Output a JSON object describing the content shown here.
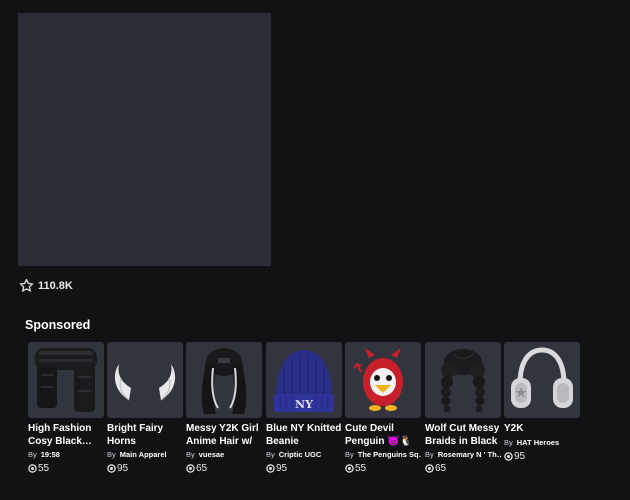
{
  "favorites": {
    "count": "110.8K"
  },
  "sponsored": {
    "title": "Sponsored",
    "by_label": "By",
    "items": [
      {
        "name": "High Fashion Cosy Black…",
        "creator": "19:58",
        "price": "55",
        "icon": "black-scarf-icon"
      },
      {
        "name": "Bright Fairy Horns",
        "creator": "Main Apparel",
        "price": "95",
        "icon": "white-horns-icon"
      },
      {
        "name": "Messy Y2K Girl Anime Hair w/ …",
        "creator": "vuesae",
        "price": "65",
        "icon": "black-hair-icon"
      },
      {
        "name": "Blue NY Knitted Beanie",
        "creator": "Criptic UGC",
        "price": "95",
        "icon": "blue-beanie-icon"
      },
      {
        "name": "Cute Devil Penguin 😈🐧",
        "creator": "The Penguins Sq…",
        "price": "55",
        "icon": "devil-penguin-icon"
      },
      {
        "name": "Wolf Cut Messy Braids in Black",
        "creator": "Rosemary N ' Th…",
        "price": "65",
        "icon": "black-braids-icon"
      },
      {
        "name": "Y2K",
        "creator": "HAT Heroes",
        "price": "95",
        "icon": "headphones-icon"
      }
    ]
  }
}
